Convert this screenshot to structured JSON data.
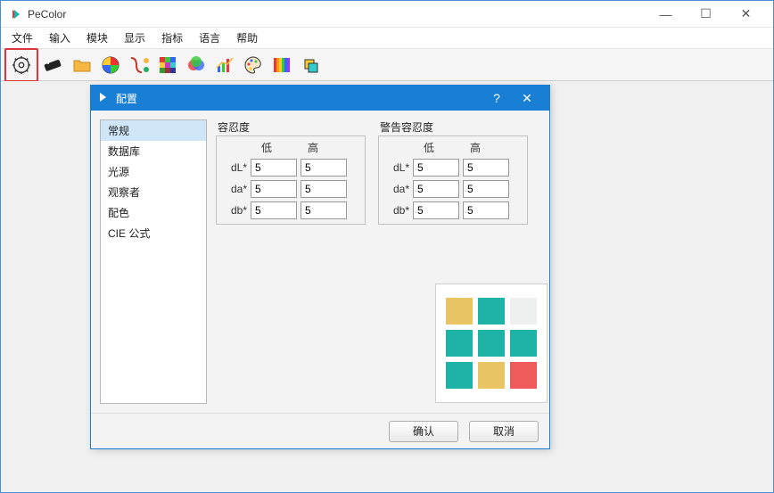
{
  "app": {
    "title": "PeColor"
  },
  "window_controls": {
    "minimize": "—",
    "maximize": "☐",
    "close": "✕"
  },
  "menu": [
    "文件",
    "输入",
    "模块",
    "显示",
    "指标",
    "语言",
    "帮助"
  ],
  "toolbar": [
    "settings",
    "tag",
    "folder",
    "color-wheel",
    "formula",
    "grid",
    "overlap",
    "chart",
    "palette",
    "rgb-bars",
    "layers"
  ],
  "highlighted_tool_index": 0,
  "dialog": {
    "title": "配置",
    "help": "?",
    "close": "✕",
    "sidebar": [
      "常规",
      "数据库",
      "光源",
      "观察者",
      "配色",
      "CIE 公式"
    ],
    "selected_index": 0,
    "tolerance": {
      "title": "容忍度",
      "headers": {
        "low": "低",
        "high": "高"
      },
      "rows": [
        {
          "label": "dL*",
          "low": "5",
          "high": "5"
        },
        {
          "label": "da*",
          "low": "5",
          "high": "5"
        },
        {
          "label": "db*",
          "low": "5",
          "high": "5"
        }
      ]
    },
    "warning_tolerance": {
      "title": "警告容忍度",
      "headers": {
        "low": "低",
        "high": "高"
      },
      "rows": [
        {
          "label": "dL*",
          "low": "5",
          "high": "5"
        },
        {
          "label": "da*",
          "low": "5",
          "high": "5"
        },
        {
          "label": "db*",
          "low": "5",
          "high": "5"
        }
      ]
    },
    "swatches": [
      "#e9c464",
      "#1fb2a6",
      "#eef0f0",
      "#1fb2a6",
      "#1fb2a6",
      "#1fb2a6",
      "#1fb2a6",
      "#e9c464",
      "#ef5a5a"
    ],
    "buttons": {
      "ok": "确认",
      "cancel": "取消"
    }
  }
}
